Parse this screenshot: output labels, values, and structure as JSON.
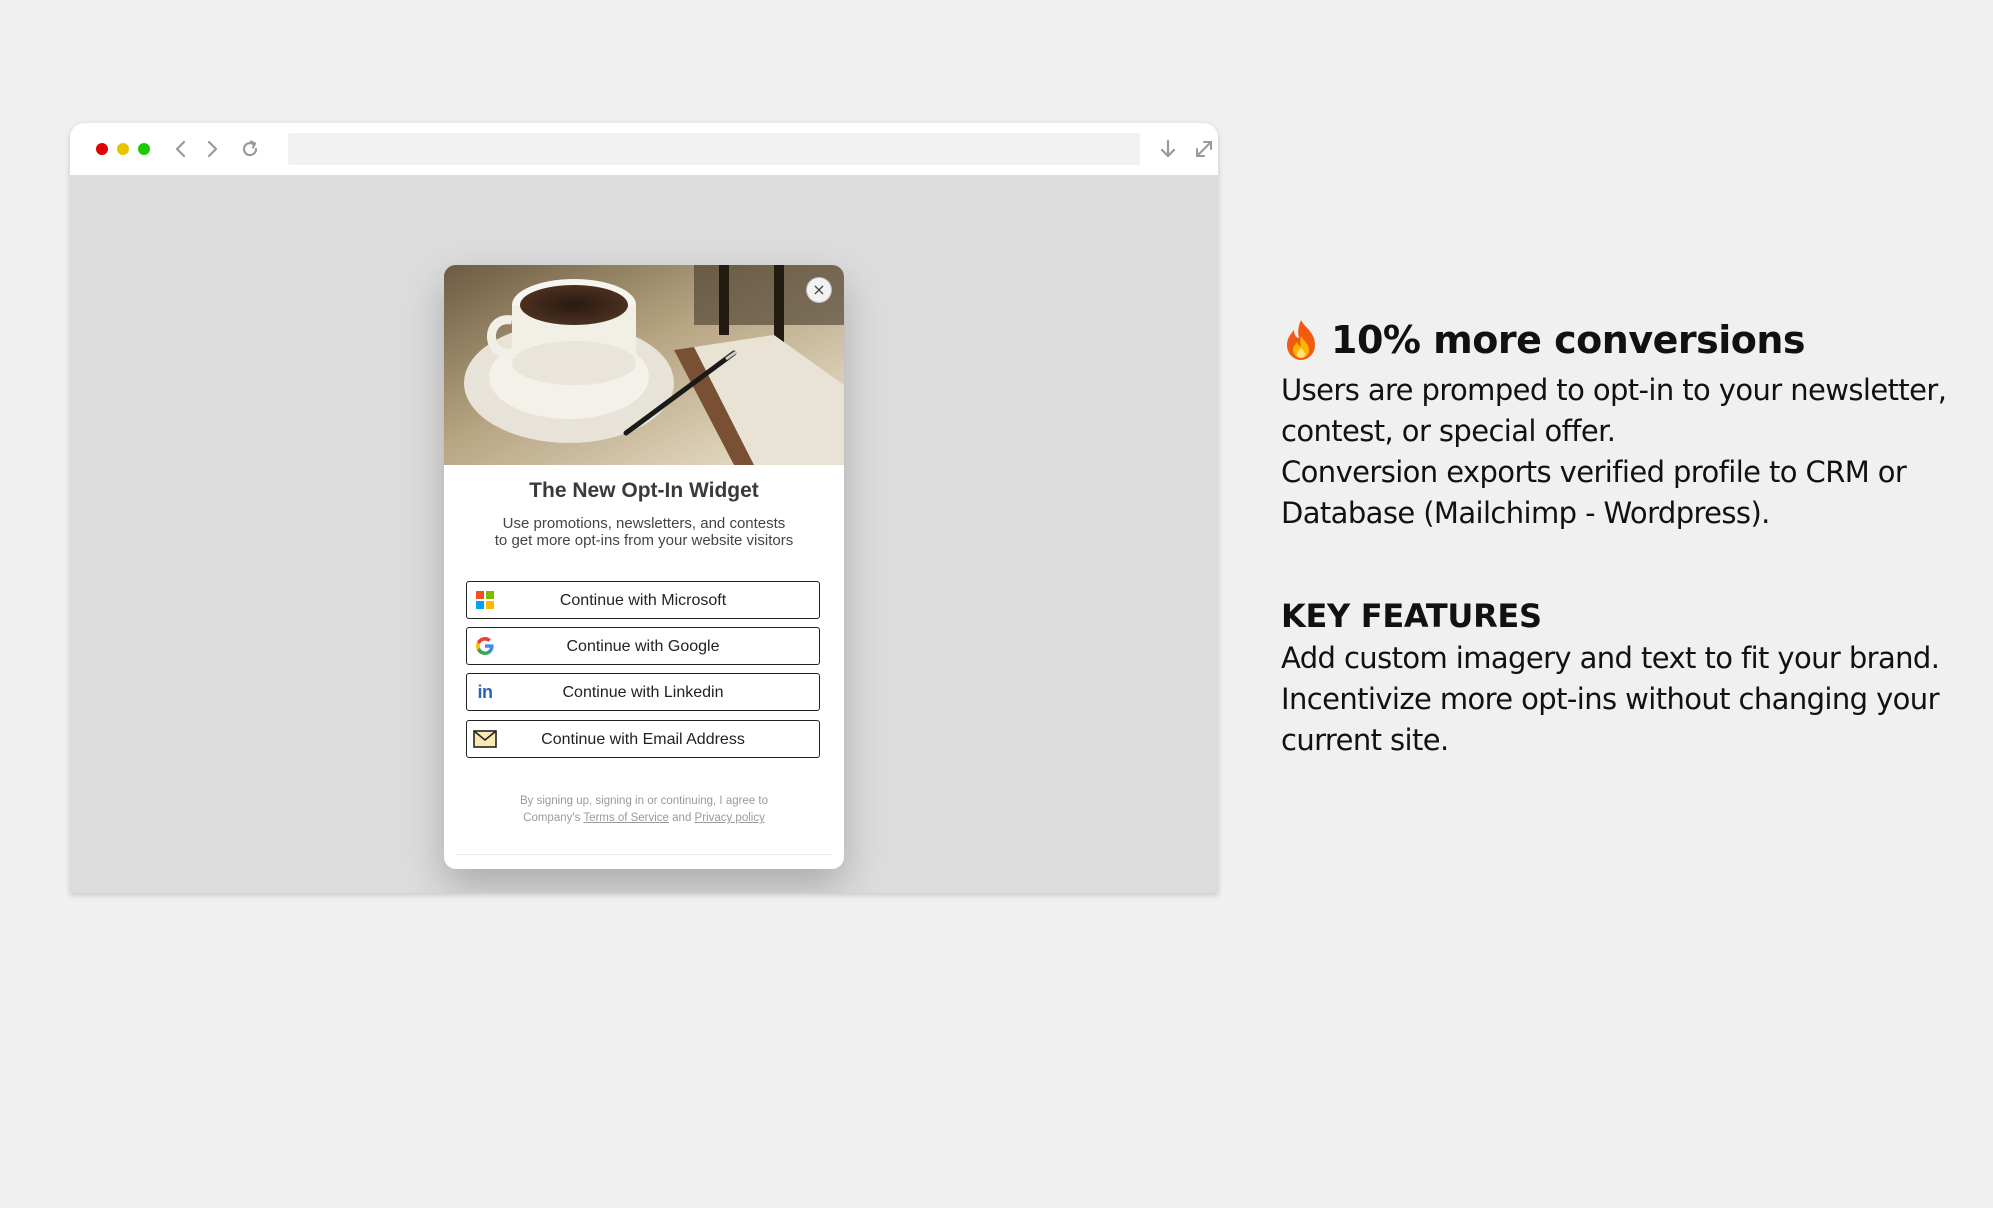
{
  "colors": {
    "dot_red": "#e00000",
    "dot_yellow": "#e8c400",
    "dot_green": "#1fc900",
    "ms_red": "#f25022",
    "ms_green": "#7fba00",
    "ms_blue": "#00a4ef",
    "ms_yellow": "#ffb900",
    "linkedin_blue": "#2867b2"
  },
  "browser": {
    "address_value": "",
    "icons": [
      "back-icon",
      "forward-icon",
      "reload-icon",
      "download-icon",
      "expand-icon",
      "menu-icon"
    ]
  },
  "modal": {
    "close_label": "×",
    "title": "The New Opt-In Widget",
    "subtitle_line1": "Use promotions, newsletters, and contests",
    "subtitle_line2": "to get more opt-ins from your website visitors",
    "buttons": [
      {
        "label": "Continue with Microsoft",
        "icon": "microsoft-icon"
      },
      {
        "label": "Continue with Google",
        "icon": "google-icon"
      },
      {
        "label": "Continue with Linkedin",
        "icon": "linkedin-icon"
      },
      {
        "label": "Continue with Email Address",
        "icon": "envelope-icon"
      }
    ],
    "linkedin_glyph": "in",
    "terms": {
      "line1": "By signing up, signing in or continuing, I agree to",
      "prefix": "Company's ",
      "tos": "Terms of Service",
      "and": " and ",
      "privacy": "Privacy policy"
    }
  },
  "copy": {
    "headline": "10% more conversions",
    "p1_line1": "Users are promped to opt-in to your newsletter,",
    "p1_line2": "contest, or special offer.",
    "p1_line3": "Conversion exports verified profile to CRM or",
    "p1_line4": "Database (Mailchimp - Wordpress).",
    "features_title": "KEY FEATURES",
    "f_line1": "Add custom imagery and text to fit your brand.",
    "f_line2": "Incentivize more opt-ins without changing your",
    "f_line3": "current site."
  }
}
